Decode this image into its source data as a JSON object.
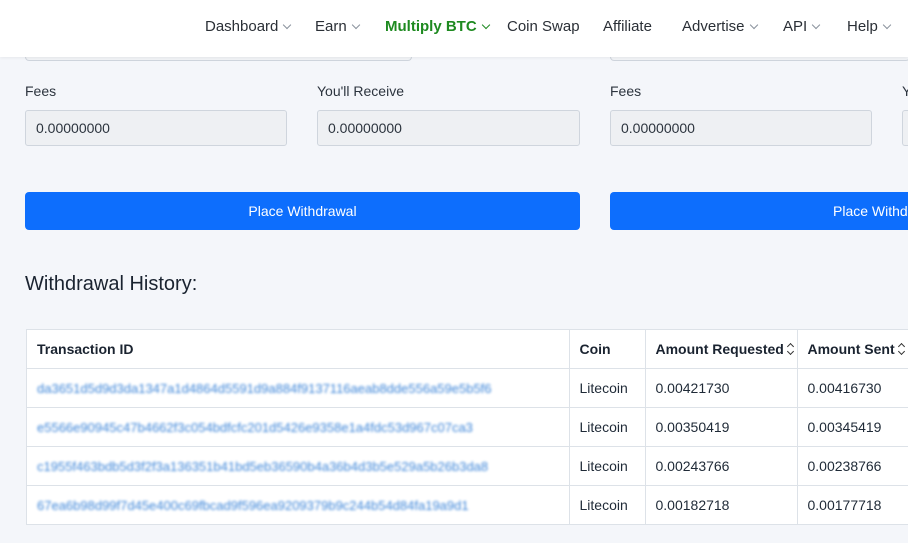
{
  "nav": {
    "items": [
      {
        "label": "Dashboard",
        "dropdown": true,
        "active": false
      },
      {
        "label": "Earn",
        "dropdown": true,
        "active": false
      },
      {
        "label": "Multiply BTC",
        "dropdown": true,
        "active": true
      },
      {
        "label": "Coin Swap",
        "dropdown": false,
        "active": false
      },
      {
        "label": "Affiliate",
        "dropdown": false,
        "active": false
      },
      {
        "label": "Advertise",
        "dropdown": true,
        "active": false
      },
      {
        "label": "API",
        "dropdown": true,
        "active": false
      },
      {
        "label": "Help",
        "dropdown": true,
        "active": false
      }
    ]
  },
  "left_form": {
    "fees_label": "Fees",
    "fees_value": "0.00000000",
    "receive_label": "You'll Receive",
    "receive_value": "0.00000000",
    "button_label": "Place Withdrawal"
  },
  "right_form": {
    "fees_label": "Fees",
    "fees_value": "0.00000000",
    "receive_label": "Y",
    "button_label": "Place Withd"
  },
  "history": {
    "title": "Withdrawal History:",
    "columns": [
      "Transaction ID",
      "Coin",
      "Amount Requested",
      "Amount Sent"
    ],
    "rows": [
      {
        "txid": "da3651d5d9d3da1347a1d4864d5591d9a884f9137116aeab8dde556a59e5b5f6",
        "coin": "Litecoin",
        "requested": "0.00421730",
        "sent": "0.00416730"
      },
      {
        "txid": "e5566e90945c47b4662f3c054bdfcfc201d5426e9358e1a4fdc53d967c07ca3",
        "coin": "Litecoin",
        "requested": "0.00350419",
        "sent": "0.00345419"
      },
      {
        "txid": "c1955f463bdb5d3f2f3a136351b41bd5eb36590b4a36b4d3b5e529a5b26b3da8",
        "coin": "Litecoin",
        "requested": "0.00243766",
        "sent": "0.00238766"
      },
      {
        "txid": "67ea6b98d99f7d45e400c69fbcad9f596ea9209379b9c244b54d84fa19a9d1",
        "coin": "Litecoin",
        "requested": "0.00182718",
        "sent": "0.00177718"
      }
    ]
  },
  "colors": {
    "primary_button": "#0d6efd",
    "active_nav": "#1e8a20",
    "link": "#1a6fd1"
  }
}
